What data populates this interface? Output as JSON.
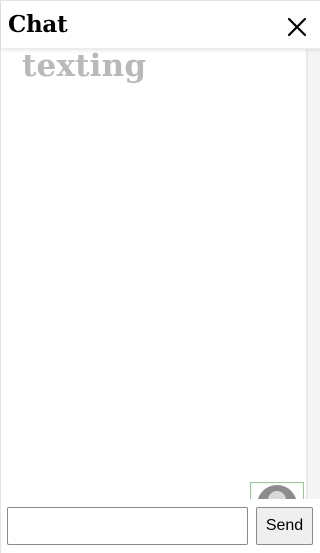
{
  "header": {
    "title": "Chat",
    "close_icon": "close-icon"
  },
  "messages": {
    "items": [
      {
        "text": "texting"
      }
    ]
  },
  "composer": {
    "input_value": "",
    "input_placeholder": "",
    "send_label": "Send"
  },
  "avatar": {
    "icon": "avatar-icon",
    "border_color": "#8fd08f"
  }
}
